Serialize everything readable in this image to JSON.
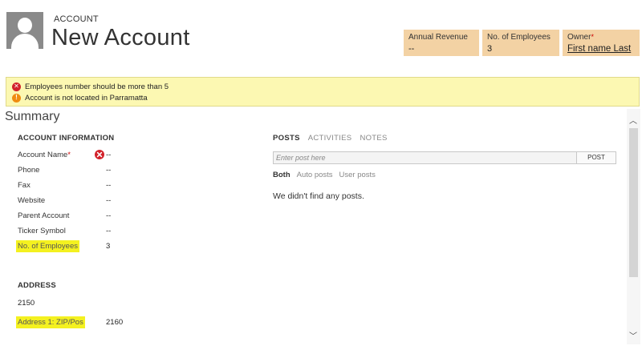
{
  "header": {
    "entity_type": "ACCOUNT",
    "title": "New Account",
    "fields": [
      {
        "label": "Annual Revenue",
        "value": "--"
      },
      {
        "label": "No. of Employees",
        "value": "3"
      },
      {
        "label": "Owner",
        "value": "First name Last",
        "required": "*"
      }
    ]
  },
  "notifications": [
    {
      "type": "error",
      "icon": "x-icon",
      "text": "Employees number should be more than 5"
    },
    {
      "type": "warning",
      "icon": "exclamation-icon",
      "text": "Account is not located in Parramatta"
    }
  ],
  "section": {
    "title": "Summary"
  },
  "account_info": {
    "title": "ACCOUNT INFORMATION",
    "fields": [
      {
        "label": "Account Name",
        "required": "*",
        "value": "--"
      },
      {
        "label": "Phone",
        "value": "--"
      },
      {
        "label": "Fax",
        "value": "--"
      },
      {
        "label": "Website",
        "value": "--"
      },
      {
        "label": "Parent Account",
        "value": "--"
      },
      {
        "label": "Ticker Symbol",
        "value": "--"
      },
      {
        "label": "No. of Employees",
        "value": "3"
      }
    ]
  },
  "address": {
    "title": "ADDRESS",
    "value": "2150",
    "zip_label": "Address 1: ZIP/Pos",
    "zip_value": "2160"
  },
  "social": {
    "tabs": [
      "POSTS",
      "ACTIVITIES",
      "NOTES"
    ],
    "post_placeholder": "Enter post here",
    "post_button": "POST",
    "filters": [
      "Both",
      "Auto posts",
      "User posts"
    ],
    "empty_message": "We didn't find any posts."
  },
  "colors": {
    "header_field_bg": "#f3d2a4",
    "notification_bg": "#fcf8b2",
    "error": "#d2222a",
    "warning": "#ef8c10",
    "highlight": "#f4f120"
  }
}
